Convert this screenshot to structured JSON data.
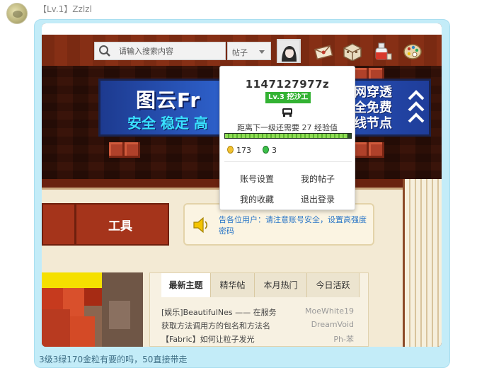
{
  "chat": {
    "sender": "【Lv.1】Zzlzl",
    "message": "3级3绿170金粒有要的吗，50直接带走"
  },
  "search": {
    "placeholder": "请输入搜索内容",
    "scope": "帖子"
  },
  "header_icons": [
    "envelope-icon",
    "cube-icon",
    "potion-icon",
    "palette-icon"
  ],
  "banner": {
    "logo": "图云Fr",
    "subtitle": "安全 稳定 高",
    "right_lines": [
      "网穿透",
      "全免费",
      "线节点"
    ]
  },
  "user_popup": {
    "user_id": "1147127977z",
    "level": "Lv.3 挖沙工",
    "exp_text": "距离下一级还需要 27 经验值",
    "exp_progress": 0.97,
    "gold": "173",
    "green": "3",
    "links": {
      "account_settings": "账号设置",
      "my_posts": "我的帖子",
      "my_favorites": "我的收藏",
      "logout": "退出登录"
    }
  },
  "nav": {
    "tool_label": "工具"
  },
  "notice": {
    "text": "告各位用户：请注意账号安全，设置高强度密码"
  },
  "tabs": [
    "最新主题",
    "精华帖",
    "本月热门",
    "今日活跃"
  ],
  "threads": [
    {
      "title": "[娱乐]BeautifulNes —— 在服务",
      "author": "MoeWhite19"
    },
    {
      "title": "获取方法调用方的包名和方法名",
      "author": "DreamVoid"
    },
    {
      "title": "【Fabric】如何让粒子发光",
      "author": "Ph-苯"
    }
  ],
  "colors": {
    "bubble": "#c3ecf8",
    "level_badge": "#33b233",
    "notice_text": "#2a76c7",
    "nav_bar": "#a5341b"
  }
}
